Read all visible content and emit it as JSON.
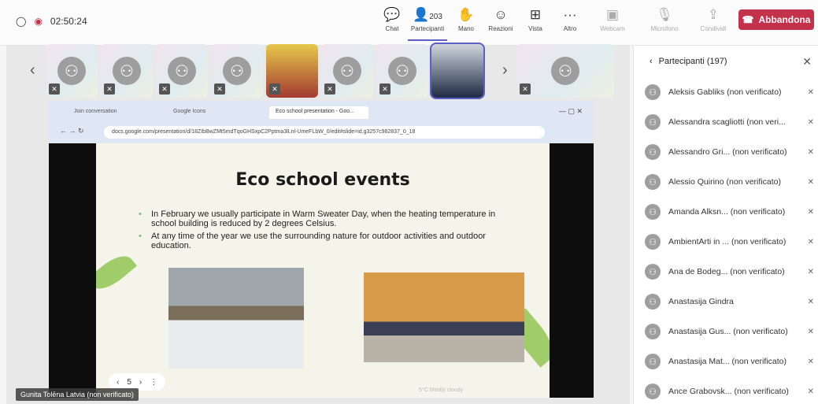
{
  "topbar": {
    "timer": "02:50:24",
    "participant_count": "203",
    "buttons": [
      {
        "label": "Chat",
        "icon": "chat-icon"
      },
      {
        "label": "Partecipanti",
        "icon": "people-icon"
      },
      {
        "label": "Mano",
        "icon": "hand-icon"
      },
      {
        "label": "Reazioni",
        "icon": "smile-icon"
      },
      {
        "label": "Vista",
        "icon": "grid-icon"
      },
      {
        "label": "Altro",
        "icon": "more-icon"
      },
      {
        "label": "Webcam",
        "icon": "camera-off-icon"
      },
      {
        "label": "Microfono",
        "icon": "mic-off-icon"
      },
      {
        "label": "Condividi",
        "icon": "share-icon"
      }
    ],
    "leave_label": "Abbandona",
    "leave_color": "#c4314b"
  },
  "browser": {
    "tabs": [
      "Join conversation",
      "Google Icons",
      "Eco school presentation - Goo..."
    ],
    "url": "docs.google.com/presentation/d/18ZIbBwZMt5mdTqoGHSxpC2Pptma3lLnl-UmeFLbW_0/edit#slide=id.g3257c982837_0_18"
  },
  "slide": {
    "title": "Eco school events",
    "bullets": [
      "In February we usually participate in Warm Sweater Day, when the heating temperature in school building is reduced by 2 degrees Celsius.",
      "At any time of the year we use the surrounding nature for outdoor activities and outdoor education."
    ],
    "page": "5"
  },
  "speaker": "Gunita Tolēna Latvia (non verificato)",
  "panel": {
    "title": "Partecipanti (197)",
    "participants": [
      "Aleksis Gabliks (non verificato)",
      "Alessandra scagliotti (non veri...",
      "Alessandro Gri... (non verificato)",
      "Alessio Quirino (non verificato)",
      "Amanda Alksn... (non verificato)",
      "AmbientArti in ... (non verificato)",
      "Ana de Bodeg... (non verificato)",
      "Anastasija Gindra",
      "Anastasija Gus... (non verificato)",
      "Anastasija Mat... (non verificato)",
      "Ance Grabovsk... (non verificato)"
    ]
  },
  "taskbar": {
    "weather": "5°C Mostly cloudy"
  }
}
